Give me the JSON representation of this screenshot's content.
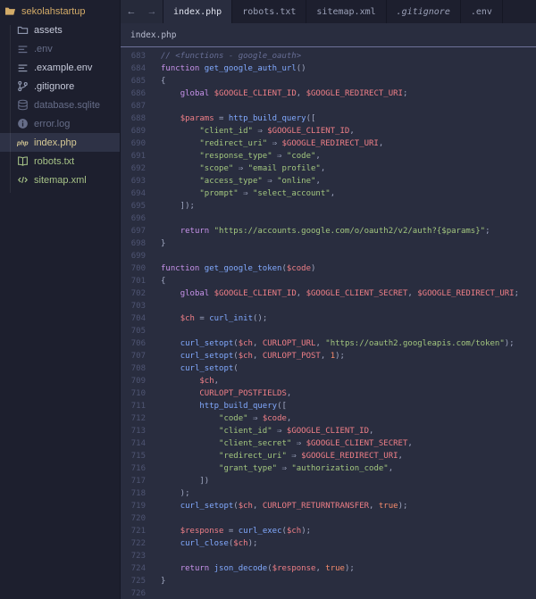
{
  "colors": {
    "editor_bg": "#292d3f",
    "panel_bg": "#1d1f2e",
    "selected_bg": "#2e3246",
    "border_dark": "#151724",
    "rule_purple": "#6e7198",
    "text_default": "#a6accd",
    "line_number": "#4f5573",
    "comment": "#676e95",
    "keyword": "#c792ea",
    "function": "#82aaff",
    "string": "#a3c77f",
    "variable": "#ef7f87",
    "number": "#f78c6c",
    "sidebar_gold": "#d3ab68",
    "sidebar_modified": "#d8cb96",
    "sidebar_added": "#a6c287",
    "sidebar_dim": "#666d88"
  },
  "sidebar": {
    "root": {
      "label": "sekolahstartup",
      "icon": "folder-open-icon",
      "state": "gold"
    },
    "items": [
      {
        "label": "assets",
        "icon": "folder-icon",
        "state": "normal",
        "selected": false
      },
      {
        "label": ".env",
        "icon": "list-icon",
        "state": "ignored",
        "selected": false
      },
      {
        "label": ".example.env",
        "icon": "list-icon",
        "state": "normal",
        "selected": false
      },
      {
        "label": ".gitignore",
        "icon": "git-branch-icon",
        "state": "normal",
        "selected": false
      },
      {
        "label": "database.sqlite",
        "icon": "database-icon",
        "state": "ignored",
        "selected": false
      },
      {
        "label": "error.log",
        "icon": "info-icon",
        "state": "ignored",
        "selected": false
      },
      {
        "label": "index.php",
        "icon": "php-icon",
        "state": "modified",
        "selected": true
      },
      {
        "label": "robots.txt",
        "icon": "book-icon",
        "state": "added",
        "selected": false
      },
      {
        "label": "sitemap.xml",
        "icon": "code-icon",
        "state": "added",
        "selected": false
      }
    ]
  },
  "tab_bar": {
    "back_arrow": "←",
    "forward_arrow": "→",
    "tabs": [
      {
        "label": "index.php",
        "active": true,
        "italic": false
      },
      {
        "label": "robots.txt",
        "active": false,
        "italic": false
      },
      {
        "label": "sitemap.xml",
        "active": false,
        "italic": false
      },
      {
        "label": ".gitignore",
        "active": false,
        "italic": true
      },
      {
        "label": ".env",
        "active": false,
        "italic": false
      }
    ]
  },
  "breadcrumb": {
    "path": "index.php"
  },
  "editor": {
    "language": "php",
    "first_line": 683,
    "last_line": 726,
    "lines": [
      {
        "n": 683,
        "s": [
          [
            "cm",
            "// <functions - google_oauth>"
          ]
        ]
      },
      {
        "n": 684,
        "s": [
          [
            "kw",
            "function "
          ],
          [
            "fn",
            "get_google_auth_url"
          ],
          [
            "pn",
            "()"
          ]
        ]
      },
      {
        "n": 685,
        "s": [
          [
            "pn",
            "{"
          ]
        ]
      },
      {
        "n": 686,
        "s": [
          [
            "pn",
            "    "
          ],
          [
            "kw",
            "global "
          ],
          [
            "var",
            "$GOOGLE_CLIENT_ID"
          ],
          [
            "pn",
            ", "
          ],
          [
            "var",
            "$GOOGLE_REDIRECT_URI"
          ],
          [
            "pn",
            ";"
          ]
        ]
      },
      {
        "n": 687,
        "s": []
      },
      {
        "n": 688,
        "s": [
          [
            "pn",
            "    "
          ],
          [
            "var",
            "$params"
          ],
          [
            "pn",
            " = "
          ],
          [
            "fn",
            "http_build_query"
          ],
          [
            "pn",
            "(["
          ]
        ]
      },
      {
        "n": 689,
        "s": [
          [
            "pn",
            "        "
          ],
          [
            "str",
            "\"client_id\""
          ],
          [
            "pn",
            " ⇒ "
          ],
          [
            "var",
            "$GOOGLE_CLIENT_ID"
          ],
          [
            "pn",
            ","
          ]
        ]
      },
      {
        "n": 690,
        "s": [
          [
            "pn",
            "        "
          ],
          [
            "str",
            "\"redirect_uri\""
          ],
          [
            "pn",
            " ⇒ "
          ],
          [
            "var",
            "$GOOGLE_REDIRECT_URI"
          ],
          [
            "pn",
            ","
          ]
        ]
      },
      {
        "n": 691,
        "s": [
          [
            "pn",
            "        "
          ],
          [
            "str",
            "\"response_type\""
          ],
          [
            "pn",
            " ⇒ "
          ],
          [
            "str",
            "\"code\""
          ],
          [
            "pn",
            ","
          ]
        ]
      },
      {
        "n": 692,
        "s": [
          [
            "pn",
            "        "
          ],
          [
            "str",
            "\"scope\""
          ],
          [
            "pn",
            " ⇒ "
          ],
          [
            "str",
            "\"email profile\""
          ],
          [
            "pn",
            ","
          ]
        ]
      },
      {
        "n": 693,
        "s": [
          [
            "pn",
            "        "
          ],
          [
            "str",
            "\"access_type\""
          ],
          [
            "pn",
            " ⇒ "
          ],
          [
            "str",
            "\"online\""
          ],
          [
            "pn",
            ","
          ]
        ]
      },
      {
        "n": 694,
        "s": [
          [
            "pn",
            "        "
          ],
          [
            "str",
            "\"prompt\""
          ],
          [
            "pn",
            " ⇒ "
          ],
          [
            "str",
            "\"select_account\""
          ],
          [
            "pn",
            ","
          ]
        ]
      },
      {
        "n": 695,
        "s": [
          [
            "pn",
            "    ]);"
          ]
        ]
      },
      {
        "n": 696,
        "s": []
      },
      {
        "n": 697,
        "s": [
          [
            "pn",
            "    "
          ],
          [
            "kw",
            "return "
          ],
          [
            "str",
            "\"https://accounts.google.com/o/oauth2/v2/auth?{$params}\""
          ],
          [
            "pn",
            ";"
          ]
        ]
      },
      {
        "n": 698,
        "s": [
          [
            "pn",
            "}"
          ]
        ]
      },
      {
        "n": 699,
        "s": []
      },
      {
        "n": 700,
        "s": [
          [
            "kw",
            "function "
          ],
          [
            "fn",
            "get_google_token"
          ],
          [
            "pn",
            "("
          ],
          [
            "var",
            "$code"
          ],
          [
            "pn",
            ")"
          ]
        ]
      },
      {
        "n": 701,
        "s": [
          [
            "pn",
            "{"
          ]
        ]
      },
      {
        "n": 702,
        "s": [
          [
            "pn",
            "    "
          ],
          [
            "kw",
            "global "
          ],
          [
            "var",
            "$GOOGLE_CLIENT_ID"
          ],
          [
            "pn",
            ", "
          ],
          [
            "var",
            "$GOOGLE_CLIENT_SECRET"
          ],
          [
            "pn",
            ", "
          ],
          [
            "var",
            "$GOOGLE_REDIRECT_URI"
          ],
          [
            "pn",
            ";"
          ]
        ]
      },
      {
        "n": 703,
        "s": []
      },
      {
        "n": 704,
        "s": [
          [
            "pn",
            "    "
          ],
          [
            "var",
            "$ch"
          ],
          [
            "pn",
            " = "
          ],
          [
            "fn",
            "curl_init"
          ],
          [
            "pn",
            "();"
          ]
        ]
      },
      {
        "n": 705,
        "s": []
      },
      {
        "n": 706,
        "s": [
          [
            "pn",
            "    "
          ],
          [
            "fn",
            "curl_setopt"
          ],
          [
            "pn",
            "("
          ],
          [
            "var",
            "$ch"
          ],
          [
            "pn",
            ", "
          ],
          [
            "var",
            "CURLOPT_URL"
          ],
          [
            "pn",
            ", "
          ],
          [
            "str",
            "\"https://oauth2.googleapis.com/token\""
          ],
          [
            "pn",
            ");"
          ]
        ]
      },
      {
        "n": 707,
        "s": [
          [
            "pn",
            "    "
          ],
          [
            "fn",
            "curl_setopt"
          ],
          [
            "pn",
            "("
          ],
          [
            "var",
            "$ch"
          ],
          [
            "pn",
            ", "
          ],
          [
            "var",
            "CURLOPT_POST"
          ],
          [
            "pn",
            ", "
          ],
          [
            "num",
            "1"
          ],
          [
            "pn",
            ");"
          ]
        ]
      },
      {
        "n": 708,
        "s": [
          [
            "pn",
            "    "
          ],
          [
            "fn",
            "curl_setopt"
          ],
          [
            "pn",
            "("
          ]
        ]
      },
      {
        "n": 709,
        "s": [
          [
            "pn",
            "        "
          ],
          [
            "var",
            "$ch"
          ],
          [
            "pn",
            ","
          ]
        ]
      },
      {
        "n": 710,
        "s": [
          [
            "pn",
            "        "
          ],
          [
            "var",
            "CURLOPT_POSTFIELDS"
          ],
          [
            "pn",
            ","
          ]
        ]
      },
      {
        "n": 711,
        "s": [
          [
            "pn",
            "        "
          ],
          [
            "fn",
            "http_build_query"
          ],
          [
            "pn",
            "(["
          ]
        ]
      },
      {
        "n": 712,
        "s": [
          [
            "pn",
            "            "
          ],
          [
            "str",
            "\"code\""
          ],
          [
            "pn",
            " ⇒ "
          ],
          [
            "var",
            "$code"
          ],
          [
            "pn",
            ","
          ]
        ]
      },
      {
        "n": 713,
        "s": [
          [
            "pn",
            "            "
          ],
          [
            "str",
            "\"client_id\""
          ],
          [
            "pn",
            " ⇒ "
          ],
          [
            "var",
            "$GOOGLE_CLIENT_ID"
          ],
          [
            "pn",
            ","
          ]
        ]
      },
      {
        "n": 714,
        "s": [
          [
            "pn",
            "            "
          ],
          [
            "str",
            "\"client_secret\""
          ],
          [
            "pn",
            " ⇒ "
          ],
          [
            "var",
            "$GOOGLE_CLIENT_SECRET"
          ],
          [
            "pn",
            ","
          ]
        ]
      },
      {
        "n": 715,
        "s": [
          [
            "pn",
            "            "
          ],
          [
            "str",
            "\"redirect_uri\""
          ],
          [
            "pn",
            " ⇒ "
          ],
          [
            "var",
            "$GOOGLE_REDIRECT_URI"
          ],
          [
            "pn",
            ","
          ]
        ]
      },
      {
        "n": 716,
        "s": [
          [
            "pn",
            "            "
          ],
          [
            "str",
            "\"grant_type\""
          ],
          [
            "pn",
            " ⇒ "
          ],
          [
            "str",
            "\"authorization_code\""
          ],
          [
            "pn",
            ","
          ]
        ]
      },
      {
        "n": 717,
        "s": [
          [
            "pn",
            "        ])"
          ]
        ]
      },
      {
        "n": 718,
        "s": [
          [
            "pn",
            "    );"
          ]
        ]
      },
      {
        "n": 719,
        "s": [
          [
            "pn",
            "    "
          ],
          [
            "fn",
            "curl_setopt"
          ],
          [
            "pn",
            "("
          ],
          [
            "var",
            "$ch"
          ],
          [
            "pn",
            ", "
          ],
          [
            "var",
            "CURLOPT_RETURNTRANSFER"
          ],
          [
            "pn",
            ", "
          ],
          [
            "num",
            "true"
          ],
          [
            "pn",
            ");"
          ]
        ]
      },
      {
        "n": 720,
        "s": []
      },
      {
        "n": 721,
        "s": [
          [
            "pn",
            "    "
          ],
          [
            "var",
            "$response"
          ],
          [
            "pn",
            " = "
          ],
          [
            "fn",
            "curl_exec"
          ],
          [
            "pn",
            "("
          ],
          [
            "var",
            "$ch"
          ],
          [
            "pn",
            ");"
          ]
        ]
      },
      {
        "n": 722,
        "s": [
          [
            "pn",
            "    "
          ],
          [
            "fn",
            "curl_close"
          ],
          [
            "pn",
            "("
          ],
          [
            "var",
            "$ch"
          ],
          [
            "pn",
            ");"
          ]
        ]
      },
      {
        "n": 723,
        "s": []
      },
      {
        "n": 724,
        "s": [
          [
            "pn",
            "    "
          ],
          [
            "kw",
            "return "
          ],
          [
            "fn",
            "json_decode"
          ],
          [
            "pn",
            "("
          ],
          [
            "var",
            "$response"
          ],
          [
            "pn",
            ", "
          ],
          [
            "num",
            "true"
          ],
          [
            "pn",
            ");"
          ]
        ]
      },
      {
        "n": 725,
        "s": [
          [
            "pn",
            "}"
          ]
        ]
      },
      {
        "n": 726,
        "s": []
      }
    ]
  }
}
